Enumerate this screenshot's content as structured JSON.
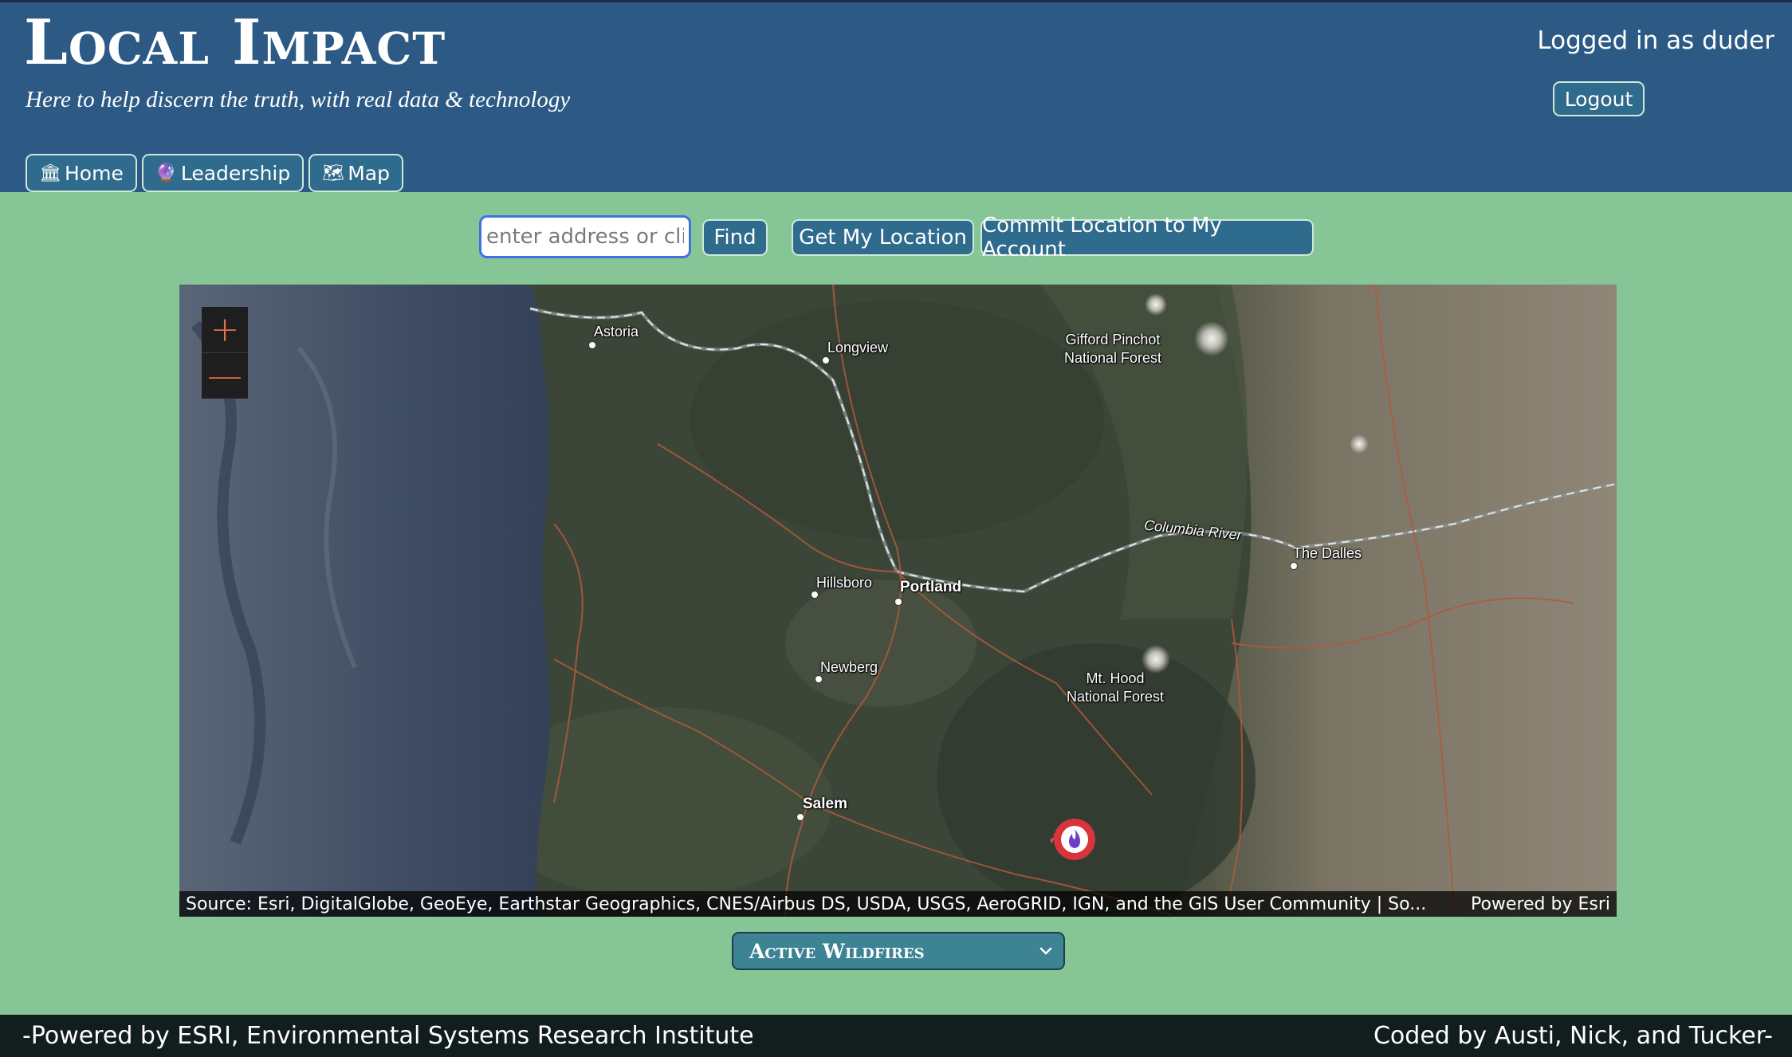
{
  "header": {
    "title": "Local Impact",
    "tagline": "Here to help discern the truth, with real data & technology",
    "logged_in_text": "Logged in as duder",
    "logout_label": "Logout"
  },
  "nav": {
    "items": [
      {
        "label": "Home",
        "icon": "bank-icon"
      },
      {
        "label": "Leadership",
        "icon": "crystal-ball-icon"
      },
      {
        "label": "Map",
        "icon": "map-icon"
      }
    ]
  },
  "search": {
    "placeholder": "enter address or click on map",
    "find_label": "Find",
    "get_location_label": "Get My Location",
    "commit_label": "Commit Location to My Account"
  },
  "map": {
    "zoom_in": "+",
    "zoom_out": "—",
    "labels": {
      "astoria": "Astoria",
      "longview": "Longview",
      "gifford_line1": "Gifford Pinchot",
      "gifford_line2": "National Forest",
      "columbia_river": "Columbia River",
      "the_dalles": "The Dalles",
      "hillsboro": "Hillsboro",
      "portland": "Portland",
      "newberg": "Newberg",
      "mt_hood_line1": "Mt. Hood",
      "mt_hood_line2": "National Forest",
      "salem": "Salem"
    },
    "attribution_source": "Source: Esri, DigitalGlobe, GeoEye, Earthstar Geographics, CNES/Airbus DS, USDA, USGS, AeroGRID, IGN, and the GIS User Community | So...",
    "attribution_powered": "Powered by Esri",
    "marker_icon": "wildfire-marker-icon",
    "colors": {
      "ocean": "#3a4a62",
      "land": "#3b4536",
      "east_land": "#7d7565",
      "roads": "#b0593c",
      "marker": "#d8343c"
    }
  },
  "layer_select": {
    "selected": "Active Wildfires"
  },
  "footer": {
    "left": "-Powered by ESRI, Environmental Systems Research Institute",
    "right": "Coded by Austi, Nick, and Tucker-"
  }
}
